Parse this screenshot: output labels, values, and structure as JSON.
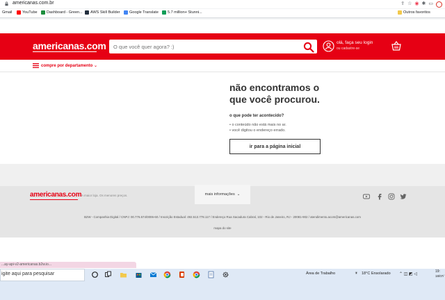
{
  "browser": {
    "url": "americanas.com.br",
    "bookmarks": [
      {
        "label": "Gmail",
        "color": "#d93025"
      },
      {
        "label": "YouTube",
        "color": "#ff0000"
      },
      {
        "label": "Dashboard - Green...",
        "color": "#1e8e3e"
      },
      {
        "label": "AWS Skill Builder",
        "color": "#232f3e"
      },
      {
        "label": "Google Translate",
        "color": "#4285f4"
      },
      {
        "label": "5.7 million+ Stunni...",
        "color": "#0f9d58"
      }
    ],
    "other_favorites": "Outros favoritos"
  },
  "header": {
    "logo": "americanas.com",
    "search_placeholder": "O que você quer agora? :)",
    "login_line1": "olá, faça seu login",
    "login_line2": "ou cadastre-se",
    "brand_color": "#e60014"
  },
  "nav": {
    "departments_label": "compre por departamento"
  },
  "error": {
    "title_line1": "não encontramos o",
    "title_line2": "que você procurou.",
    "subtitle": "o que pode ter acontecido?",
    "reasons": [
      "• o conteúdo não está mais no ar.",
      "• você digitou o endereço errado."
    ],
    "home_button": "ir para a página inicial"
  },
  "footer": {
    "logo": "americanas.com",
    "tagline": "A maior loja. Os menores preços.",
    "more_info": "mais informações",
    "legal": "B2W - Companhia Digital / CNPJ: 00.776.574/0006-60 / Inscrição Estadual: 492.513.778.117 / Endereço Rua Sacadura Cabral, 102 - Rio de Janeiro, RJ - 20081-902 / atendimento.acom@americanas.com",
    "sitemap": "mapa do site",
    "social_icons": [
      "youtube-icon",
      "facebook-icon",
      "instagram-icon",
      "twitter-icon"
    ]
  },
  "status_bar": {
    "url": "...ay-api-v2-americanas.b2w.io..."
  },
  "taskbar": {
    "search_placeholder": "igite aqui para pesquisar",
    "desktop_label": "Área de Trabalho",
    "weather": "18°C  Ensolarado",
    "time": "19:",
    "date": "18/07/"
  }
}
